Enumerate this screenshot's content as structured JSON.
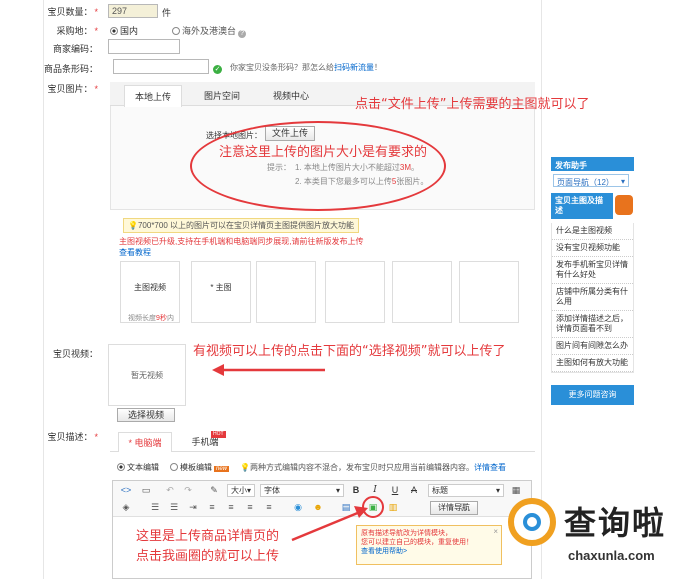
{
  "form": {
    "quantity": {
      "label": "宝贝数量：",
      "value": "297",
      "unit": "件"
    },
    "origin": {
      "label": "采购地：",
      "opt1": "国内",
      "opt2": "海外及港澳台"
    },
    "merchant_code": {
      "label": "商家编码："
    },
    "barcode": {
      "label": "商品条形码：",
      "hint": "你家宝贝没条形码？那怎么给",
      "hint_link": "扫码新流量",
      "hint_end": "！"
    },
    "images": {
      "label": "宝贝图片："
    },
    "video": {
      "label": "宝贝视频："
    },
    "desc": {
      "label": "宝贝描述："
    }
  },
  "upload": {
    "tabs": [
      "本地上传",
      "图片空间",
      "视频中心"
    ],
    "choose_label": "选择本地图片：",
    "file_button": "文件上传",
    "tip_label": "提示：",
    "tip1_pre": "1. 本地上传图片大小不能超过",
    "tip1_num": "3M",
    "tip1_end": "。",
    "tip2_pre": "2. 本类目下您最多可以上传",
    "tip2_num": "5",
    "tip2_end": "张图片。"
  },
  "banner": {
    "size_tip": "700*700 以上的图片可以在宝贝详情页主图提供图片放大功能",
    "video_upgrade": "主图视频已升级,支持在手机端和电脑端同步展现,请前往新版发布上传",
    "view_tutorial": "查看教程"
  },
  "slots": {
    "video_label": "主图视频",
    "video_len": "视频长度",
    "video_len_num": "9秒",
    "video_len_end": "内",
    "main_label": "* 主图"
  },
  "video_box": {
    "empty": "暂无视频",
    "select_button": "选择视频"
  },
  "desc_tabs": {
    "pc": "* 电脑端",
    "mobile": "手机端",
    "hot": "HOT"
  },
  "editor_mode": {
    "text_editor": "文本编辑",
    "template_editor": "模板编辑",
    "new_badge": "new",
    "notice": "两种方式编辑内容不混合，发布宝贝时只应用当前编辑器内容。",
    "detail_link": "详情查看"
  },
  "toolbar": {
    "size": "大小",
    "font": "字体",
    "style": "标题",
    "detail_nav": "详情导航"
  },
  "popup": {
    "line1": "原有描述导航改为详情模块，",
    "line2": "您可以建立自己的模块，重复使用！",
    "line3": "查看使用帮助>"
  },
  "sidebar": {
    "title": "发布助手",
    "nav": "页面导航（12）",
    "section": "宝贝主图及描述",
    "items": [
      "什么是主图视频",
      "没有宝贝视频功能",
      "发布手机新宝贝详情有什么好处",
      "店铺中所属分类有什么用",
      "添加详情描述之后，详情页面看不到",
      "图片间有间隙怎么办",
      "主图如何有放大功能"
    ],
    "more": "更多问题咨询"
  },
  "annotations": {
    "a1": "点击“文件上传”上传需要的主图就可以了",
    "a2": "注意这里上传的图片大小是有要求的",
    "a3": "有视频可以上传的点击下面的“选择视频”就可以上传了",
    "a4_l1": "这里是上传商品详情页的",
    "a4_l2": "点击我画圈的就可以上传"
  },
  "watermark": {
    "brand": "查询啦",
    "url": "chaxunla.com"
  },
  "colors": {
    "annotation": "#e4393c",
    "sidebar_blue": "#2a8fd8",
    "link": "#0066cc"
  }
}
